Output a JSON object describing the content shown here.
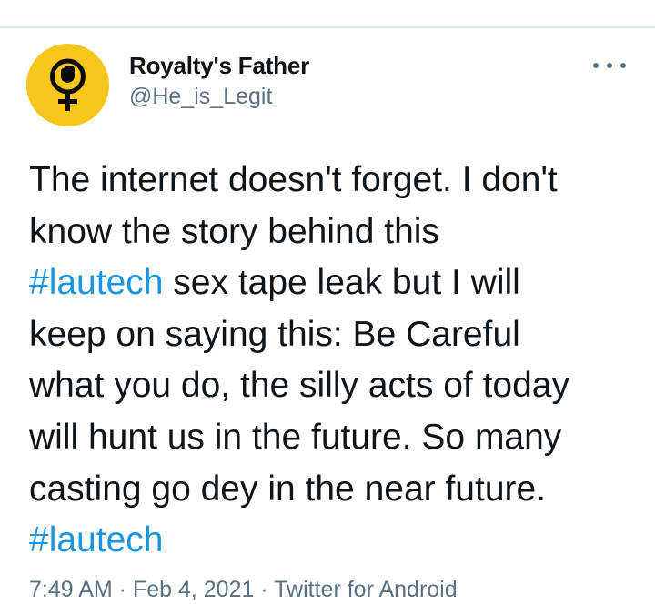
{
  "author": {
    "display_name": "Royalty's Father",
    "handle": "@He_is_Legit",
    "avatar_icon": "raised-fist-venus-symbol-icon",
    "avatar_color": "#f7c61b"
  },
  "more_icon": "more-horizontal-icon",
  "tweet": {
    "lines": [
      [
        {
          "text": "The internet doesn't forget. I don't",
          "hashtag": false
        }
      ],
      [
        {
          "text": "know the story behind this",
          "hashtag": false
        }
      ],
      [
        {
          "text": "#lautech",
          "hashtag": true
        },
        {
          "text": " sex tape leak but I will",
          "hashtag": false
        }
      ],
      [
        {
          "text": "keep on saying this: Be Careful",
          "hashtag": false
        }
      ],
      [
        {
          "text": "what you do, the silly acts of today",
          "hashtag": false
        }
      ],
      [
        {
          "text": "will hunt us in the future. So many",
          "hashtag": false
        }
      ],
      [
        {
          "text": "casting go dey in the near future.",
          "hashtag": false
        }
      ],
      [
        {
          "text": "#lautech",
          "hashtag": true
        }
      ]
    ]
  },
  "meta": {
    "time": "7:49 AM",
    "separator": " · ",
    "date": "Feb 4, 2021",
    "source": "Twitter for Android"
  },
  "colors": {
    "text": "#0f1419",
    "secondary": "#5b7083",
    "hashtag": "#1b95e0",
    "divider": "#dce3e8"
  }
}
